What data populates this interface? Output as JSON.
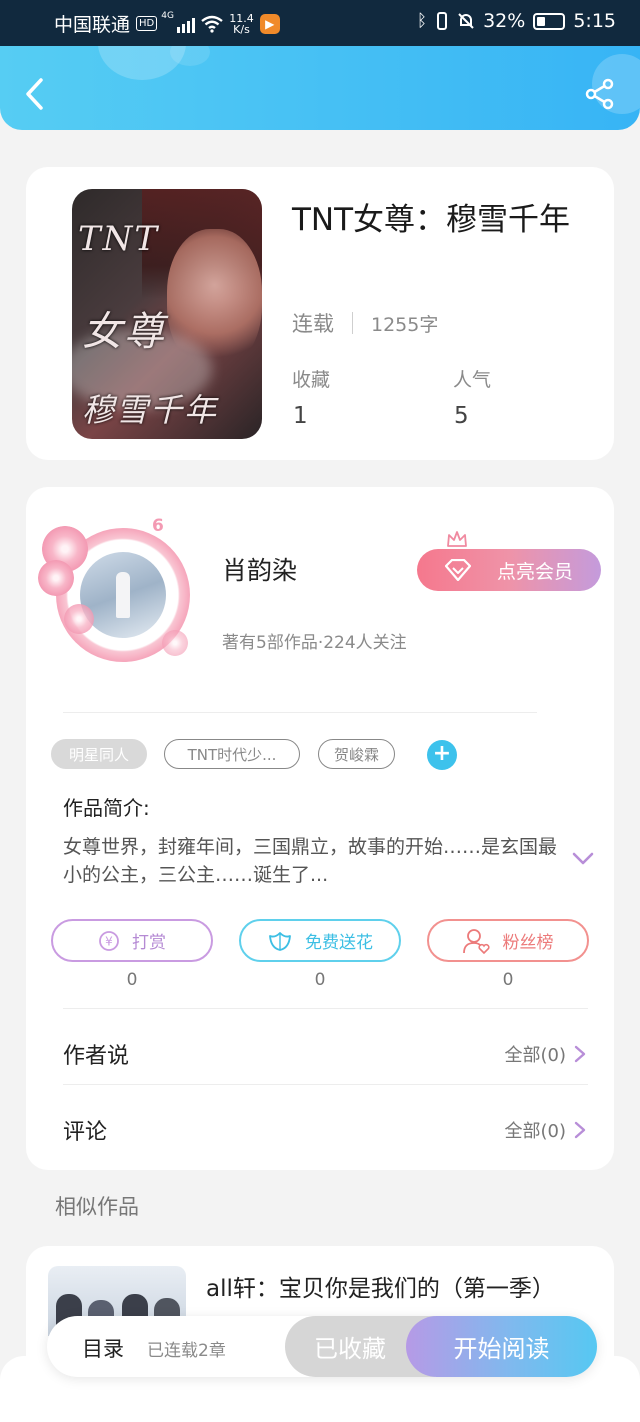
{
  "status_bar": {
    "carrier": "中国联通",
    "hd": "HD",
    "net": "4G",
    "speed_value": "11.4",
    "speed_unit": "K/s",
    "battery": "32%",
    "time": "5:15"
  },
  "book": {
    "title": "TNT女尊：穆雪千年",
    "status": "连载",
    "word_count": "1255字",
    "favorites_label": "收藏",
    "favorites_value": "1",
    "popularity_label": "人气",
    "popularity_value": "5",
    "cover_text": {
      "line1": "TNT",
      "line2": "女尊",
      "line3": "穆雪千年"
    }
  },
  "author": {
    "level": "6",
    "name": "肖韵染",
    "info": "著有5部作品·224人关注",
    "vip_button": "点亮会员"
  },
  "tags": [
    "明星同人",
    "TNT时代少...",
    "贺峻霖"
  ],
  "intro": {
    "heading": "作品简介:",
    "text": "女尊世界，封雍年间，三国鼎立，故事的开始……是玄国最小的公主，三公主……诞生了..."
  },
  "actions": {
    "reward_label": "打赏",
    "reward_count": "0",
    "flower_label": "免费送花",
    "flower_count": "0",
    "fans_label": "粉丝榜",
    "fans_count": "0"
  },
  "rows": {
    "author_says": "作者说",
    "author_says_right": "全部(0)",
    "comments": "评论",
    "comments_right": "全部(0)"
  },
  "similar": {
    "heading": "相似作品",
    "item_title": "all轩：宝贝你是我们的（第一季）"
  },
  "bottom": {
    "toc": "目录",
    "toc_sub": "已连载2章",
    "favorited": "已收藏",
    "start_reading": "开始阅读"
  },
  "colors": {
    "header_gradient": [
      "#56cdf3",
      "#37b4f5"
    ],
    "accent_blue": "#3dc2ec",
    "vip_gradient": [
      "#f5788d",
      "#c49bdc"
    ]
  }
}
